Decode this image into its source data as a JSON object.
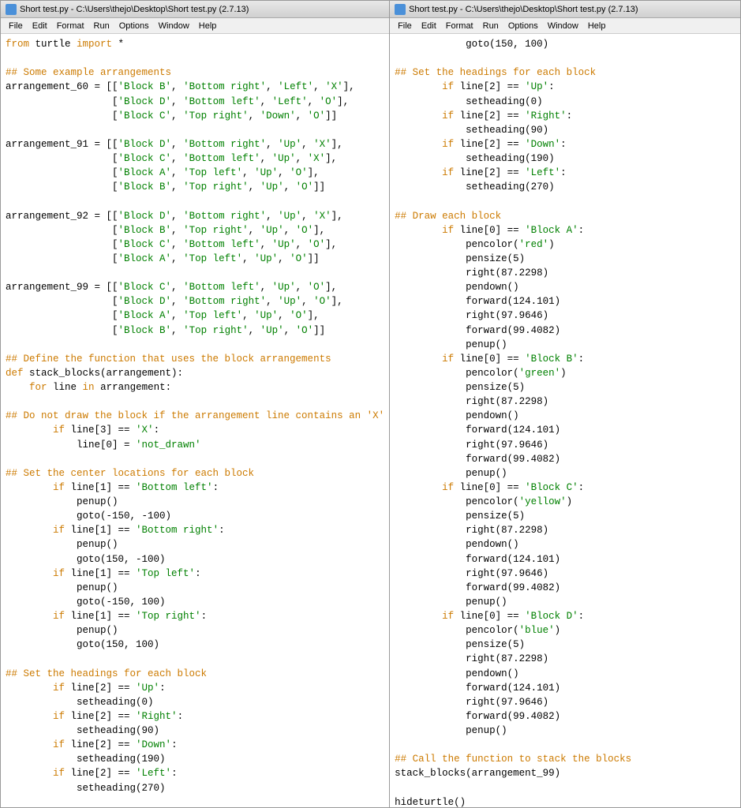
{
  "windows": [
    {
      "title": "Short test.py - C:\\Users\\thejo\\Desktop\\Short test.py (2.7.13)",
      "menus": [
        "File",
        "Edit",
        "Format",
        "Run",
        "Options",
        "Window",
        "Help"
      ]
    },
    {
      "title": "Short test.py - C:\\Users\\thejo\\Desktop\\Short test.py (2.7.13)",
      "menus": [
        "File",
        "Edit",
        "Format",
        "Run",
        "Options",
        "Window",
        "Help"
      ]
    }
  ]
}
